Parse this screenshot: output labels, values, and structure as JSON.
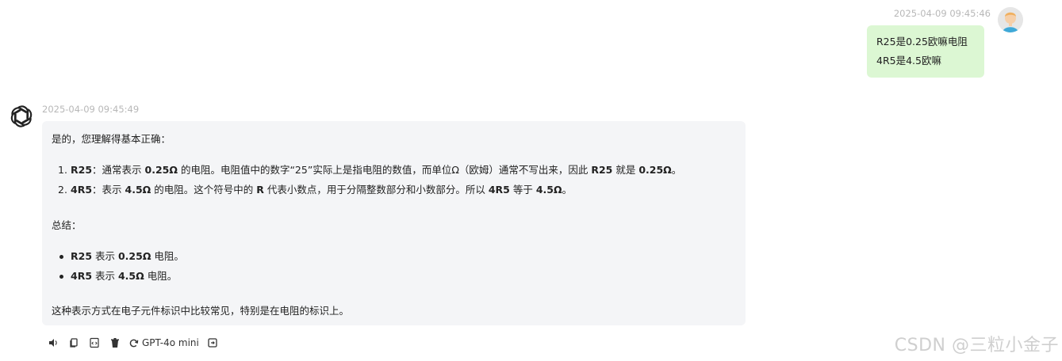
{
  "user_message": {
    "timestamp": "2025-04-09 09:45:46",
    "lines": [
      "R25是0.25欧嘛电阻",
      "4R5是4.5欧嘛"
    ]
  },
  "assistant_message": {
    "timestamp": "2025-04-09 09:45:49",
    "intro": "是的，您理解得基本正确：",
    "ordered_items": [
      {
        "num": "1.",
        "parts": [
          "R25",
          "：通常表示 ",
          "0.25Ω",
          " 的电阻。电阻值中的数字“25”实际上是指电阻的数值，而单位Ω（欧姆）通常不写出来，因此 ",
          "R25",
          " 就是 ",
          "0.25Ω",
          "。"
        ]
      },
      {
        "num": "2.",
        "parts": [
          "4R5",
          "：表示 ",
          "4.5Ω",
          " 的电阻。这个符号中的 ",
          "R",
          " 代表小数点，用于分隔整数部分和小数部分。所以 ",
          "4R5",
          " 等于 ",
          "4.5Ω",
          "。"
        ]
      }
    ],
    "summary_label": "总结：",
    "bullet_items": [
      {
        "parts": [
          "R25",
          " 表示 ",
          "0.25Ω",
          " 电阻。"
        ]
      },
      {
        "parts": [
          "4R5",
          " 表示 ",
          "4.5Ω",
          " 电阻。"
        ]
      }
    ],
    "conclusion": "这种表示方式在电子元件标识中比较常见，特别是在电阻的标识上。"
  },
  "toolbar": {
    "icons": [
      "speaker-icon",
      "copy-icon",
      "code-icon",
      "trash-icon",
      "regenerate-icon",
      "export-icon"
    ],
    "model_label": "GPT-4o mini"
  },
  "watermark": "CSDN @三粒小金子"
}
